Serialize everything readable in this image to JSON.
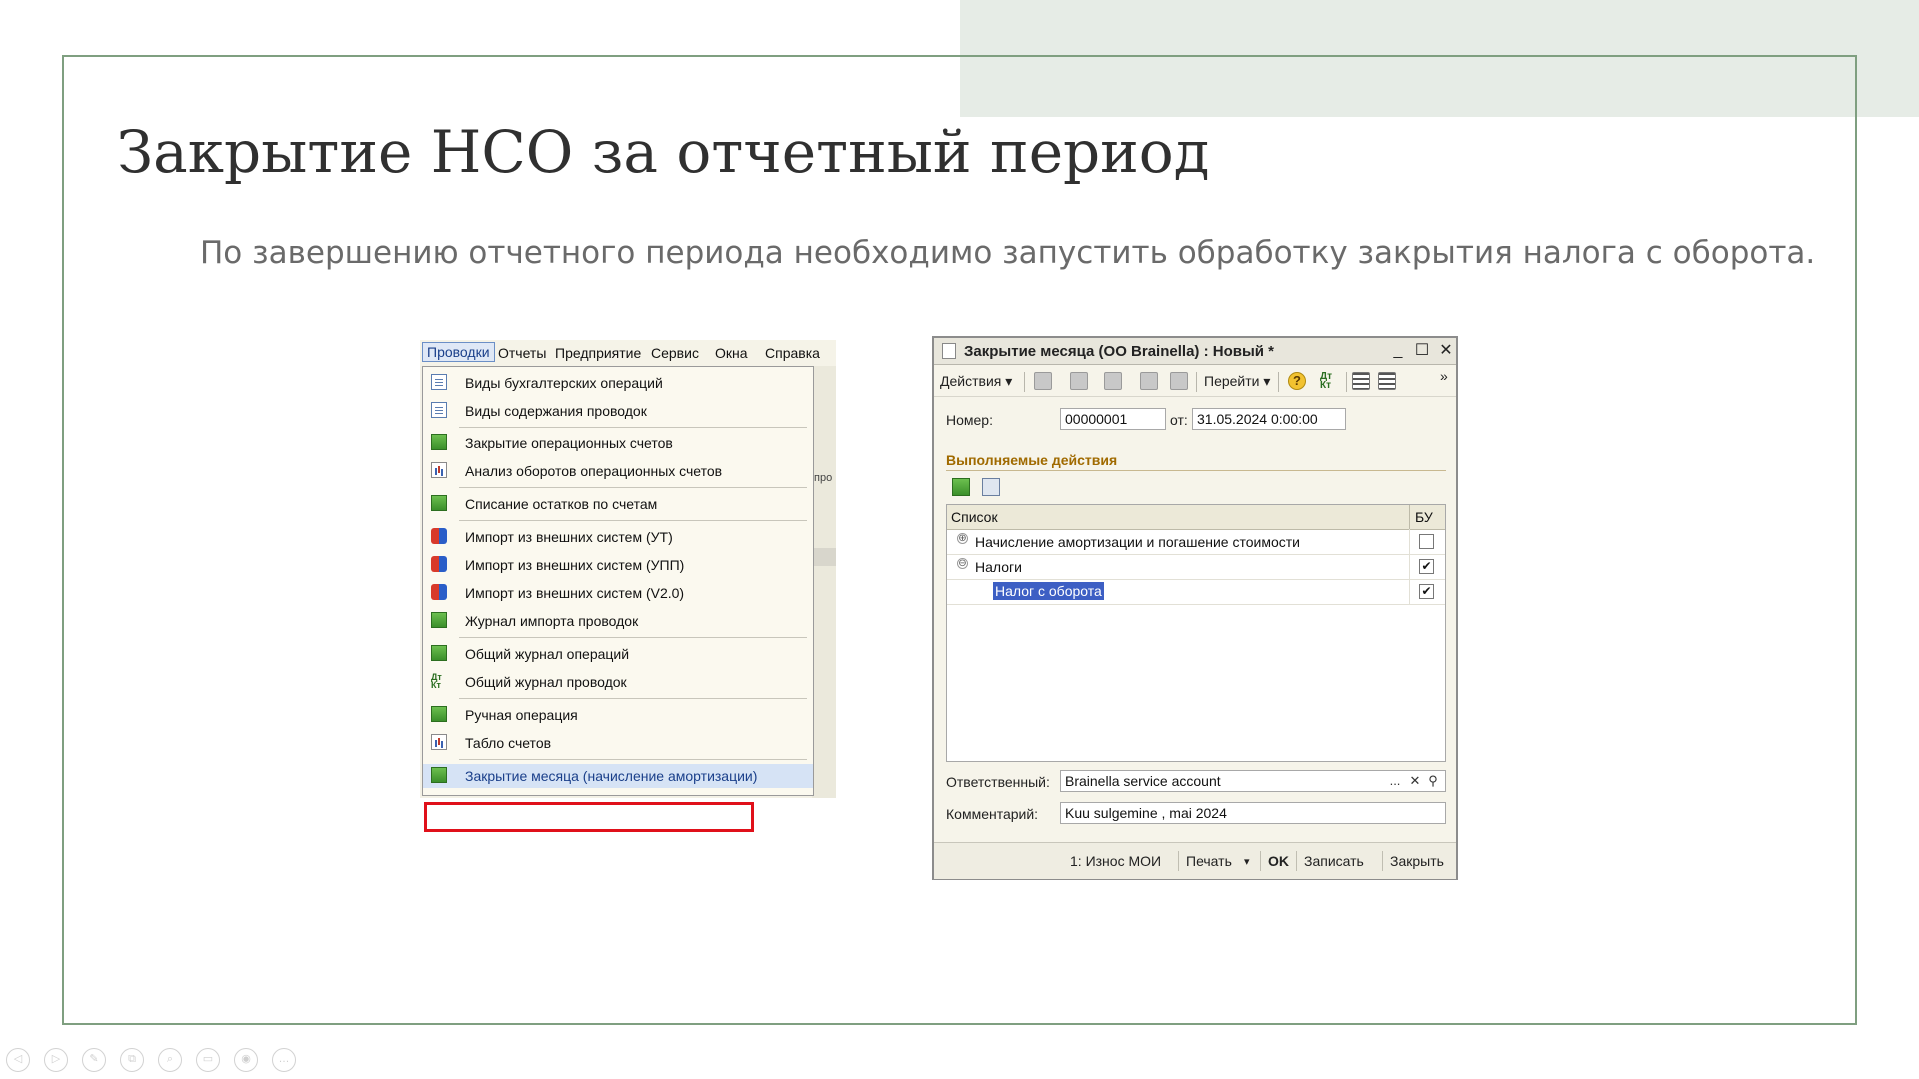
{
  "slide": {
    "title": "Закрытие НСО за отчетный период",
    "subtitle": "По завершению отчетного периода необходимо запустить обработку закрытия налога с оборота."
  },
  "menu_shot": {
    "menubar": [
      "Проводки",
      "Отчеты",
      "Предприятие",
      "Сервис",
      "Окна",
      "Справка"
    ],
    "bg_fragment": "про",
    "items": [
      {
        "label": "Виды бухгалтерских операций",
        "icon": "doc-icon"
      },
      {
        "label": "Виды содержания проводок",
        "icon": "doc-icon"
      },
      {
        "label": "Закрытие операционных счетов",
        "icon": "green-doc-icon"
      },
      {
        "label": "Анализ оборотов операционных счетов",
        "icon": "chart-icon"
      },
      {
        "label": "Списание остатков по счетам",
        "icon": "green-doc-icon"
      },
      {
        "label": "Импорт из внешних систем (УТ)",
        "icon": "import-icon"
      },
      {
        "label": "Импорт из внешних систем (УПП)",
        "icon": "import-icon"
      },
      {
        "label": "Импорт из внешних систем (V2.0)",
        "icon": "import-icon"
      },
      {
        "label": "Журнал импорта проводок",
        "icon": "green-doc-icon"
      },
      {
        "label": "Общий журнал операций",
        "icon": "green-doc-icon"
      },
      {
        "label": "Общий журнал проводок",
        "icon": "dt-kt-icon"
      },
      {
        "label": "Ручная операция",
        "icon": "green-doc-icon"
      },
      {
        "label": "Табло счетов",
        "icon": "chart-icon"
      },
      {
        "label": "Закрытие месяца (начисление амортизации)",
        "icon": "green-doc-icon"
      }
    ],
    "dt_text": "Дт Кт"
  },
  "dialog": {
    "title": "Закрытие месяца (ОО Brainella) : Новый *",
    "win_min": "_",
    "win_max": "☐",
    "win_close": "✕",
    "toolbar": {
      "actions": "Действия ▾",
      "goto": "Перейти ▾",
      "help": "?",
      "dt_kt": "Дт Кт",
      "more": "»"
    },
    "number_label": "Номер:",
    "number_value": "00000001",
    "date_label": "от:",
    "date_value": "31.05.2024  0:00:00",
    "section_title": "Выполняемые действия",
    "table": {
      "col_list": "Список",
      "col_bu": "БУ",
      "rows": [
        {
          "text": "Начисление амортизации и погашение стоимости",
          "expander": "⊕",
          "checked": "",
          "level": 0
        },
        {
          "text": "Налоги",
          "expander": "⊖",
          "checked": "✔",
          "level": 0
        },
        {
          "text": "Налог с оборота",
          "expander": "",
          "checked": "✔",
          "level": 1,
          "selected": true
        }
      ]
    },
    "responsible_label": "Ответственный:",
    "responsible_value": "Brainella service account",
    "responsible_btns": [
      "...",
      "✕",
      "⚲"
    ],
    "comment_label": "Комментарий:",
    "comment_value": "Kuu sulgemine , mai 2024",
    "buttons": {
      "wear": "1: Износ МОИ",
      "print": "Печать",
      "print_arrow": "▾",
      "ok": "OK",
      "save": "Записать",
      "close": "Закрыть"
    }
  },
  "slide_controls": [
    "◁",
    "▷",
    "✎",
    "⧉",
    "⌕",
    "▭",
    "◉",
    "…"
  ]
}
